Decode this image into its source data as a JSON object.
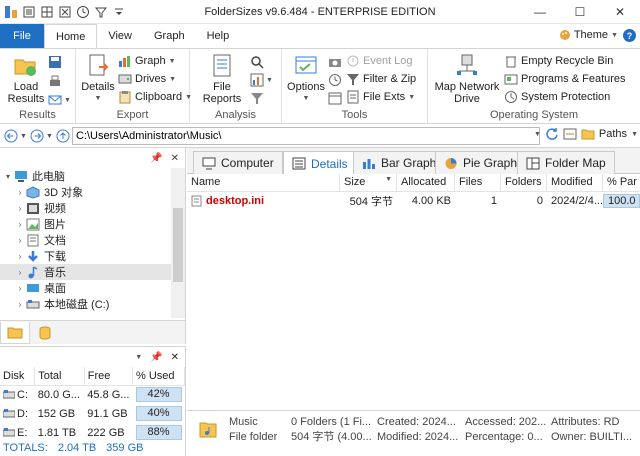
{
  "window": {
    "title": "FolderSizes v9.6.484 - ENTERPRISE EDITION",
    "minimize": "—",
    "maximize": "☐",
    "close": "✕"
  },
  "tabs": {
    "file": "File",
    "items": [
      "Home",
      "View",
      "Graph",
      "Help"
    ],
    "active": "Home",
    "theme": "Theme",
    "help": "?"
  },
  "ribbon": {
    "results": {
      "label": "Results",
      "load": "Load Results"
    },
    "export": {
      "label": "Export",
      "details": "Details",
      "graph": "Graph",
      "drives": "Drives",
      "clipboard": "Clipboard"
    },
    "analysis": {
      "label": "Analysis",
      "file_reports": "File Reports"
    },
    "tools": {
      "label": "Tools",
      "options": "Options",
      "event_log": "Event Log",
      "filter_zip": "Filter & Zip",
      "file_exts": "File Exts"
    },
    "operating_system": {
      "label": "Operating System",
      "map_network_drive": "Map Network Drive",
      "empty_recycle_bin": "Empty Recycle Bin",
      "programs_features": "Programs & Features",
      "system_protection": "System Protection"
    }
  },
  "address": {
    "path": "C:\\Users\\Administrator\\Music\\",
    "paths_label": "Paths"
  },
  "tree": {
    "items": [
      {
        "label": "此电脑",
        "icon": "computer-icon"
      },
      {
        "label": "3D 对象",
        "icon": "3d-objects-icon"
      },
      {
        "label": "视频",
        "icon": "videos-icon"
      },
      {
        "label": "图片",
        "icon": "pictures-icon"
      },
      {
        "label": "文档",
        "icon": "documents-icon"
      },
      {
        "label": "下载",
        "icon": "downloads-icon"
      },
      {
        "label": "音乐",
        "icon": "music-icon"
      },
      {
        "label": "桌面",
        "icon": "desktop-icon"
      },
      {
        "label": "本地磁盘 (C:)",
        "icon": "drive-icon"
      }
    ],
    "selected_index": 6
  },
  "disks": {
    "headers": [
      "Disk",
      "Total",
      "Free",
      "% Used"
    ],
    "rows": [
      {
        "disk": "C:",
        "total": "80.0 G...",
        "free": "45.8 G...",
        "used": "42%"
      },
      {
        "disk": "D:",
        "total": "152 GB",
        "free": "91.1 GB",
        "used": "40%"
      },
      {
        "disk": "E:",
        "total": "1.81 TB",
        "free": "222 GB",
        "used": "88%"
      }
    ],
    "totals_label": "TOTALS:",
    "totals_total": "2.04 TB",
    "totals_free": "359 GB"
  },
  "view_tabs": {
    "items": [
      "Computer",
      "Details",
      "Bar Graph",
      "Pie Graph",
      "Folder Map"
    ],
    "active": "Details"
  },
  "file_list": {
    "headers": [
      "Name",
      "Size",
      "Allocated",
      "Files",
      "Folders",
      "Modified",
      "% Par"
    ],
    "sort_indicator": "▼",
    "rows": [
      {
        "name": "desktop.ini",
        "size": "504 字节",
        "allocated": "4.00 KB",
        "files": "1",
        "folders": "0",
        "modified": "2024/2/4...",
        "percent": "100.0"
      }
    ]
  },
  "status": {
    "name": "Music",
    "type": "File folder",
    "folders": "0 Folders (1 Fi...",
    "size": "504 字节 (4.00...",
    "created": "Created: 2024...",
    "modified": "Modified: 2024...",
    "accessed": "Accessed: 202...",
    "percentage": "Percentage: 0...",
    "attributes": "Attributes: RD",
    "owner": "Owner: BUILTI..."
  }
}
